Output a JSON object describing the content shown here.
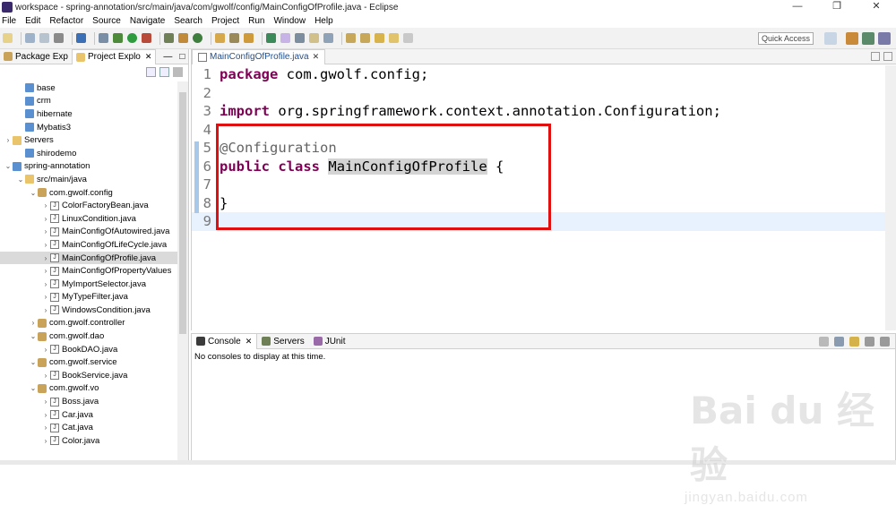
{
  "window": {
    "title": "workspace - spring-annotation/src/main/java/com/gwolf/config/MainConfigOfProfile.java - Eclipse",
    "controls": [
      "—",
      "❐",
      "✕"
    ]
  },
  "menu": [
    "File",
    "Edit",
    "Refactor",
    "Source",
    "Navigate",
    "Search",
    "Project",
    "Run",
    "Window",
    "Help"
  ],
  "toolbar": {
    "quick_access_placeholder": "Quick Access"
  },
  "left_panel": {
    "tabs": [
      {
        "label": "Package Exp",
        "icon": "package-explorer-icon",
        "active": false
      },
      {
        "label": "Project Explo",
        "icon": "project-explorer-icon",
        "active": true
      }
    ],
    "tree": [
      {
        "indent": 1,
        "arrow": "",
        "icon": "proj",
        "label": "base"
      },
      {
        "indent": 1,
        "arrow": "",
        "icon": "proj",
        "label": "crm"
      },
      {
        "indent": 1,
        "arrow": "",
        "icon": "proj",
        "label": "hibernate"
      },
      {
        "indent": 1,
        "arrow": "",
        "icon": "proj",
        "label": "Mybatis3"
      },
      {
        "indent": 0,
        "arrow": "›",
        "icon": "folder",
        "label": "Servers"
      },
      {
        "indent": 1,
        "arrow": "",
        "icon": "proj",
        "label": "shirodemo"
      },
      {
        "indent": 0,
        "arrow": "⌄",
        "icon": "proj",
        "label": "spring-annotation"
      },
      {
        "indent": 1,
        "arrow": "⌄",
        "icon": "folder",
        "label": "src/main/java"
      },
      {
        "indent": 2,
        "arrow": "⌄",
        "icon": "pkg",
        "label": "com.gwolf.config"
      },
      {
        "indent": 3,
        "arrow": "›",
        "icon": "jfile",
        "label": "ColorFactoryBean.java"
      },
      {
        "indent": 3,
        "arrow": "›",
        "icon": "jfile",
        "label": "LinuxCondition.java"
      },
      {
        "indent": 3,
        "arrow": "›",
        "icon": "jfile",
        "label": "MainConfigOfAutowired.java"
      },
      {
        "indent": 3,
        "arrow": "›",
        "icon": "jfile",
        "label": "MainConfigOfLifeCycle.java"
      },
      {
        "indent": 3,
        "arrow": "›",
        "icon": "jfile",
        "label": "MainConfigOfProfile.java",
        "selected": true
      },
      {
        "indent": 3,
        "arrow": "›",
        "icon": "jfile",
        "label": "MainConfigOfPropertyValues"
      },
      {
        "indent": 3,
        "arrow": "›",
        "icon": "jfile",
        "label": "MyImportSelector.java"
      },
      {
        "indent": 3,
        "arrow": "›",
        "icon": "jfile",
        "label": "MyTypeFilter.java"
      },
      {
        "indent": 3,
        "arrow": "›",
        "icon": "jfile",
        "label": "WindowsCondition.java"
      },
      {
        "indent": 2,
        "arrow": "›",
        "icon": "pkg",
        "label": "com.gwolf.controller"
      },
      {
        "indent": 2,
        "arrow": "⌄",
        "icon": "pkg",
        "label": "com.gwolf.dao"
      },
      {
        "indent": 3,
        "arrow": "›",
        "icon": "jfile",
        "label": "BookDAO.java"
      },
      {
        "indent": 2,
        "arrow": "⌄",
        "icon": "pkg",
        "label": "com.gwolf.service"
      },
      {
        "indent": 3,
        "arrow": "›",
        "icon": "jfile",
        "label": "BookService.java"
      },
      {
        "indent": 2,
        "arrow": "⌄",
        "icon": "pkg",
        "label": "com.gwolf.vo"
      },
      {
        "indent": 3,
        "arrow": "›",
        "icon": "jfile",
        "label": "Boss.java"
      },
      {
        "indent": 3,
        "arrow": "›",
        "icon": "jfile",
        "label": "Car.java"
      },
      {
        "indent": 3,
        "arrow": "›",
        "icon": "jfile",
        "label": "Cat.java"
      },
      {
        "indent": 3,
        "arrow": "›",
        "icon": "jfile",
        "label": "Color.java"
      }
    ]
  },
  "editor": {
    "tab_label": "MainConfigOfProfile.java",
    "lines": [
      {
        "num": "1",
        "tokens": [
          {
            "t": "package",
            "c": "kw"
          },
          {
            "t": " com.gwolf.config;",
            "c": ""
          }
        ]
      },
      {
        "num": "2",
        "tokens": []
      },
      {
        "num": "3",
        "tokens": [
          {
            "t": "import",
            "c": "kw"
          },
          {
            "t": " org.springframework.context.annotation.Configuration;",
            "c": ""
          }
        ]
      },
      {
        "num": "4",
        "tokens": []
      },
      {
        "num": "5",
        "tokens": [
          {
            "t": "@Configuration",
            "c": "ann"
          }
        ]
      },
      {
        "num": "6",
        "tokens": [
          {
            "t": "public",
            "c": "kw"
          },
          {
            "t": " ",
            "c": ""
          },
          {
            "t": "class",
            "c": "kw"
          },
          {
            "t": " ",
            "c": ""
          },
          {
            "t": "MainConfigOfProfile",
            "c": "hl"
          },
          {
            "t": " {",
            "c": ""
          }
        ]
      },
      {
        "num": "7",
        "tokens": []
      },
      {
        "num": "8",
        "tokens": [
          {
            "t": "}",
            "c": ""
          }
        ]
      },
      {
        "num": "9",
        "tokens": [],
        "current": true
      }
    ]
  },
  "console": {
    "tabs": [
      {
        "label": "Console",
        "icon": "console-icon",
        "active": true
      },
      {
        "label": "Servers",
        "icon": "servers-icon",
        "active": false
      },
      {
        "label": "JUnit",
        "icon": "junit-icon",
        "active": false
      }
    ],
    "message": "No consoles to display at this time."
  },
  "watermark": {
    "logo": "Bai du 经验",
    "url": "jingyan.baidu.com"
  },
  "colors": {
    "keyword": "#7f0055",
    "annotation": "#646464",
    "highlight_box": "#e01010",
    "current_line": "#e8f2fe"
  }
}
